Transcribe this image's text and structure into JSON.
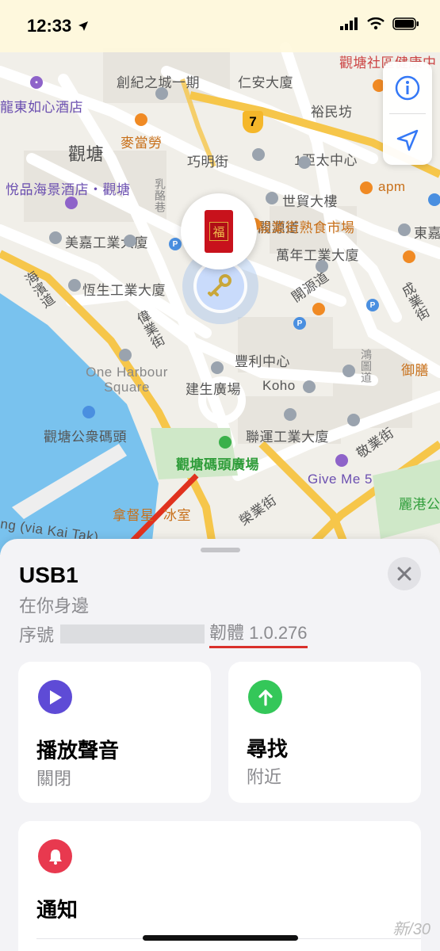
{
  "status_bar": {
    "time": "12:33"
  },
  "map": {
    "labels": {
      "tsun_yip": "創紀之城一期",
      "yan_tai": "仁安大廈",
      "kwun_tong_society": "觀塘社區健康中",
      "dragon_hotel": "龍東如心酒店",
      "kwun_tong": "觀塘",
      "mcdonalds": "麥當勞",
      "hau_ming": "巧明街",
      "yu_man": "裕民坊",
      "one_asia": "1亞太中心",
      "apm": "apm",
      "yue_ka": "悅品海景酒店・觀塘",
      "yu_lok": "乳酪巷",
      "sai_kong": "世貿大樓",
      "kong_kai": "東嘉",
      "mei_ka": "美嘉工業大廈",
      "hoi_yip_market": "駿業街熟食市場",
      "man_nin": "萬年工業大廈",
      "ha_yu": "海濱道",
      "hang_sang": "恆生工業大廈",
      "wai_yip": "偉業街",
      "hoi_yuen": "開源道",
      "shing_yip": "成業街",
      "hung_to": "鴻圖道",
      "one_harbour": "One Harbour Square",
      "fung_lee": "豐利中心",
      "kin_sang": "建生廣場",
      "koho": "Koho",
      "yu_tin": "御膳",
      "kwun_tong_pier": "觀塘公衆碼頭",
      "luen_wan": "聯運工業大廈",
      "king_yip": "敬業街",
      "pier_plaza": "觀塘碼頭廣場",
      "give_me_5": "Give Me 5",
      "lai_kong": "麗港公",
      "nadu": "拿督星",
      "ice_room": "冰室",
      "wing_yip": "榮業街",
      "kai_tak_road": "ng (via Kai Tak)",
      "route_num": "7"
    }
  },
  "pin": {
    "envelope_char": "福"
  },
  "sheet": {
    "item_name": "USB1",
    "item_status": "在你身邊",
    "serial_label": "序號",
    "firmware": "韌體 1.0.276",
    "cards": {
      "play_sound": {
        "title": "播放聲音",
        "sub": "關閉"
      },
      "find": {
        "title": "尋找",
        "sub": "附近"
      },
      "notify": {
        "title": "通知"
      }
    },
    "watermark": "新/30"
  },
  "colors": {
    "accent": "#3478f6",
    "play": "#5e4bd6",
    "find": "#34c759",
    "notify": "#e8394f",
    "annotation": "#e0321e"
  }
}
